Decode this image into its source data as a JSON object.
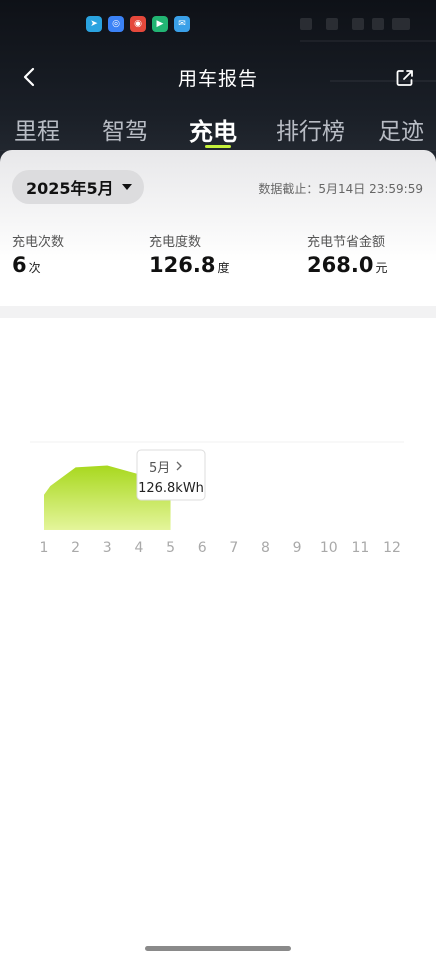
{
  "status_bar": {
    "app_icons": [
      {
        "name": "telegram-icon",
        "color": "#2aa3e0",
        "glyph": "➤"
      },
      {
        "name": "browser-icon",
        "color": "#3b82f6",
        "glyph": "◎"
      },
      {
        "name": "weibo-icon",
        "color": "#e5483b",
        "glyph": "◉"
      },
      {
        "name": "video-icon",
        "color": "#22b573",
        "glyph": "▶"
      },
      {
        "name": "mail-icon",
        "color": "#3aa0e8",
        "glyph": "✉"
      }
    ]
  },
  "header": {
    "title": "用车报告",
    "back_icon": "chevron-left-icon",
    "share_icon": "share-icon"
  },
  "tabs": [
    {
      "label": "里程",
      "active": false
    },
    {
      "label": "智驾",
      "active": false
    },
    {
      "label": "充电",
      "active": true
    },
    {
      "label": "排行榜",
      "active": false
    },
    {
      "label": "足迹",
      "active": false
    }
  ],
  "summary": {
    "month_selector": "2025年5月",
    "cutoff_text": "数据截止：5月14日 23:59:59",
    "stats": [
      {
        "label": "充电次数",
        "value": "6",
        "unit": "次"
      },
      {
        "label": "充电度数",
        "value": "126.8",
        "unit": "度"
      },
      {
        "label": "充电节省金额",
        "value": "268.0",
        "unit": "元"
      }
    ]
  },
  "colors": {
    "accent": "#c6f13c",
    "area_top": "#a8d81e",
    "area_bottom": "#e4f59b"
  },
  "chart_data": {
    "type": "area",
    "categories": [
      "1",
      "2",
      "3",
      "4",
      "5",
      "6",
      "7",
      "8",
      "9",
      "10",
      "11",
      "12"
    ],
    "x": [
      1,
      1.2,
      2,
      3,
      4,
      5
    ],
    "y": [
      72,
      90,
      128,
      132,
      114,
      126.8
    ],
    "xlim": [
      1,
      12
    ],
    "ylim": [
      0,
      180
    ],
    "grid": true,
    "tooltip": {
      "month": "5月",
      "value": "126.8kWh"
    }
  }
}
